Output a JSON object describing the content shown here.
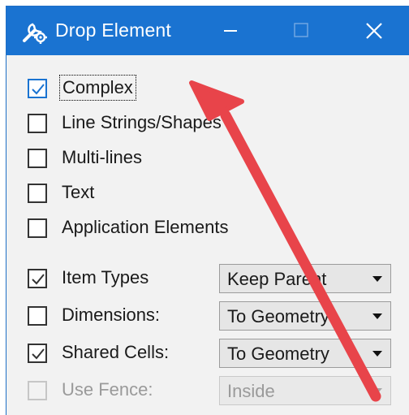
{
  "window": {
    "title": "Drop Element",
    "title_icon": "wrench-gear-icon",
    "controls": {
      "minimize_icon": "minimize-icon",
      "maximize_icon": "maximize-icon",
      "close_icon": "close-icon"
    }
  },
  "options": [
    {
      "label": "Complex",
      "checked": true,
      "disabled": false
    },
    {
      "label": "Line Strings/Shapes",
      "checked": false,
      "disabled": false
    },
    {
      "label": "Multi-lines",
      "checked": false,
      "disabled": false
    },
    {
      "label": "Text",
      "checked": false,
      "disabled": false
    },
    {
      "label": "Application Elements",
      "checked": false,
      "disabled": false
    }
  ],
  "settings": [
    {
      "label": "Item Types",
      "checked": true,
      "disabled": false,
      "select_value": "Keep Parent"
    },
    {
      "label": "Dimensions:",
      "checked": false,
      "disabled": false,
      "select_value": "To Geometry"
    },
    {
      "label": "Shared Cells:",
      "checked": true,
      "disabled": false,
      "select_value": "To Geometry"
    },
    {
      "label": "Use Fence:",
      "checked": false,
      "disabled": true,
      "select_value": "Inside"
    }
  ],
  "colors": {
    "titlebar": "#1a73d1",
    "annotation_arrow": "#e8444a"
  }
}
